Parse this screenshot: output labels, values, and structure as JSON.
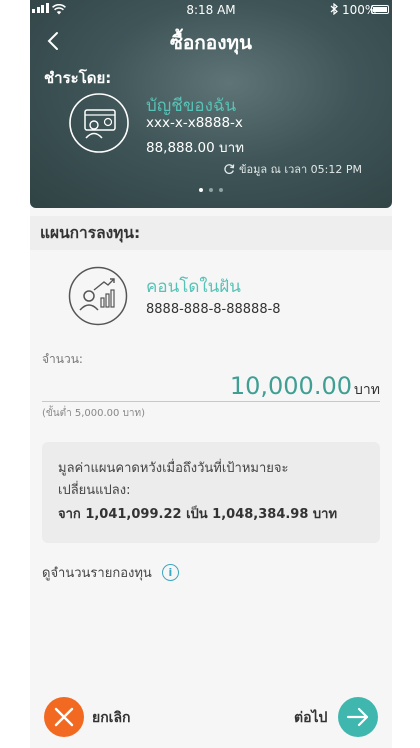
{
  "status_bar": {
    "time": "8:18 AM",
    "battery": "100%",
    "icons": [
      "signal-icon",
      "wifi-icon",
      "bluetooth-icon",
      "battery-icon"
    ]
  },
  "header": {
    "title": "ซื้อกองทุน",
    "back_icon": "chevron-left-icon"
  },
  "payment": {
    "label": "ชำระโดย:",
    "account_name": "บัญชีของฉัน",
    "account_number": "xxx-x-x8888-x",
    "balance": "88,888.00 บาท",
    "updated": "ข้อมูล ณ เวลา 05:12 PM",
    "icon": "bank-card-user-icon",
    "page_indicator": {
      "current": 1,
      "total": 3
    }
  },
  "plan": {
    "section_label": "แผนการลงทุน:",
    "name": "คอนโดในฝัน",
    "number": "8888-888-8-88888-8",
    "icon": "investor-growth-icon"
  },
  "amount": {
    "label": "จำนวน:",
    "value": "10,000.00",
    "unit": "บาท",
    "minimum": "(ขั้นต่ำ 5,000.00 บาท)"
  },
  "projection": {
    "line1": "มูลค่าแผนคาดหวังเมื่อถึงวันที่เป้าหมายจะ",
    "line2": "เปลี่ยนแปลง:",
    "value": "จาก 1,041,099.22 เป็น 1,048,384.98 บาท"
  },
  "fund_details_link": "ดูจำนวนรายกองทุน",
  "footer": {
    "cancel_label": "ยกเลิก",
    "next_label": "ต่อไป"
  },
  "colors": {
    "accent_teal": "#57c2b6",
    "cancel_orange": "#f26a22",
    "next_teal": "#3fb7ae",
    "header_dark": "#3f5558"
  }
}
